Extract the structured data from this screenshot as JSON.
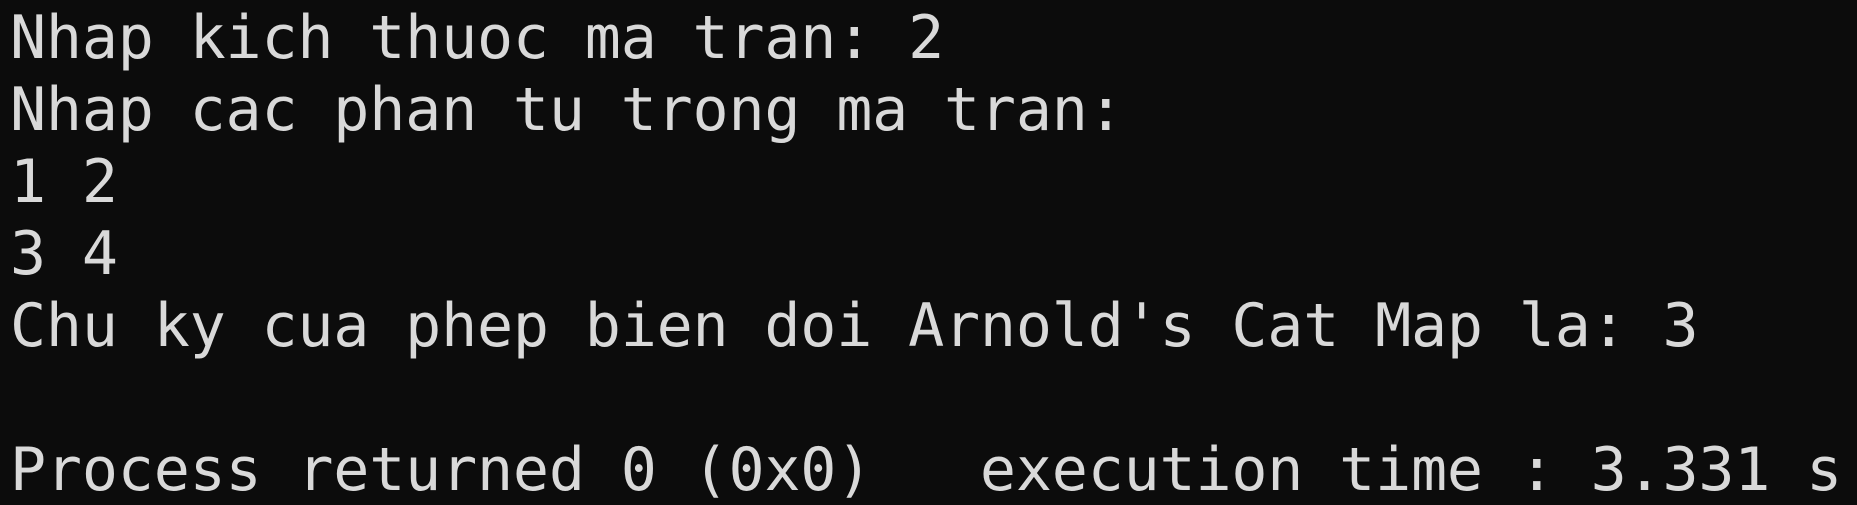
{
  "console": {
    "lines": [
      "Nhap kich thuoc ma tran: 2",
      "Nhap cac phan tu trong ma tran:",
      "1 2",
      "3 4",
      "Chu ky cua phep bien doi Arnold's Cat Map la: 3",
      "",
      "Process returned 0 (0x0)   execution time : 3.331 s"
    ]
  },
  "colors": {
    "background": "#0c0c0c",
    "text": "#d9d9d9"
  }
}
